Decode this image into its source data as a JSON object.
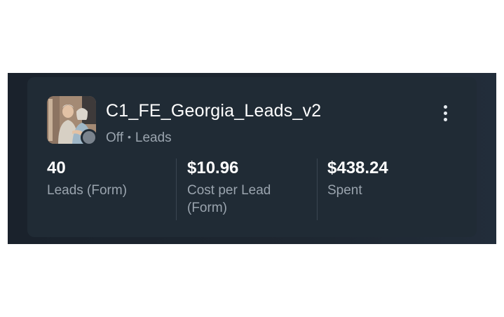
{
  "campaign": {
    "name": "C1_FE_Georgia_Leads_v2",
    "status": "Off",
    "separator": "•",
    "objective": "Leads"
  },
  "metrics": [
    {
      "value": "40",
      "label": "Leads (Form)"
    },
    {
      "value": "$10.96",
      "label": "Cost per Lead (Form)"
    },
    {
      "value": "$438.24",
      "label": "Spent"
    }
  ],
  "icons": {
    "more": "more-vertical-icon",
    "status": "status-off-dot"
  },
  "colors": {
    "card_background": "#202b35",
    "text_primary": "#ffffff",
    "text_secondary": "#9aa4ae",
    "status_off": "#7a838d"
  }
}
